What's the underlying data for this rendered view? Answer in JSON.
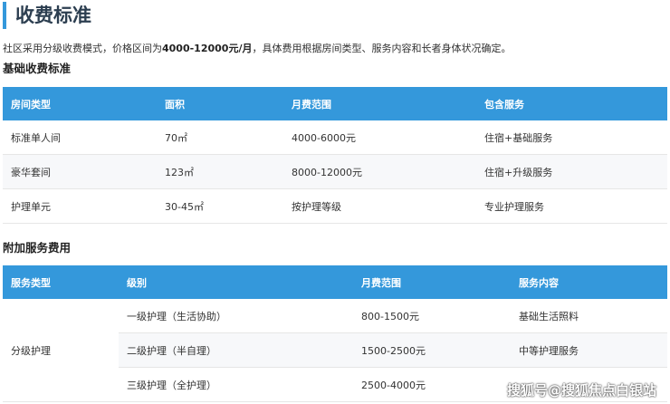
{
  "title": "收费标准",
  "desc": {
    "pre": "社区采用分级收费模式，价格区间为",
    "bold": "4000-12000元/月",
    "post": "，具体费用根据房间类型、服务内容和长者身体状况确定。"
  },
  "basic": {
    "heading": "基础收费标准",
    "headers": [
      "房间类型",
      "面积",
      "月费范围",
      "包含服务"
    ],
    "rows": [
      [
        "标准单人间",
        "70㎡",
        "4000-6000元",
        "住宿+基础服务"
      ],
      [
        "豪华套间",
        "123㎡",
        "8000-12000元",
        "住宿+升级服务"
      ],
      [
        "护理单元",
        "30-45㎡",
        "按护理等级",
        "专业护理服务"
      ]
    ]
  },
  "extra": {
    "heading": "附加服务费用",
    "headers": [
      "服务类型",
      "级别",
      "月费范围",
      "服务内容"
    ],
    "group": "分级护理",
    "rows": [
      [
        "一级护理（生活协助）",
        "800-1500元",
        "基础生活照料"
      ],
      [
        "二级护理（半自理）",
        "1500-2500元",
        "中等护理服务"
      ],
      [
        "三级护理（全护理）",
        "2500-4000元",
        ""
      ]
    ]
  },
  "watermark": "搜狐号@搜狐焦点白银站"
}
